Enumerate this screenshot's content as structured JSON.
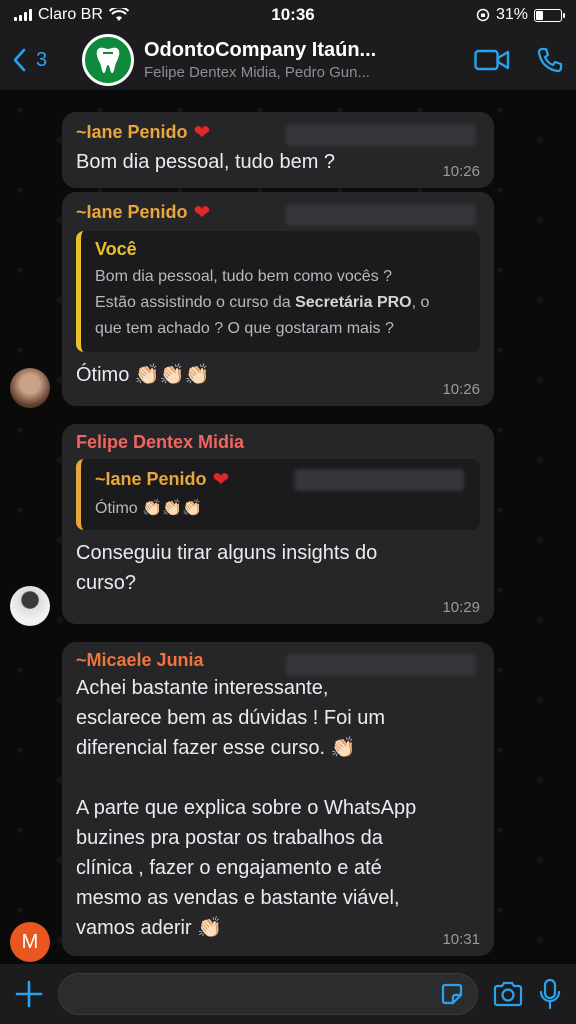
{
  "status": {
    "carrier": "Claro BR",
    "time": "10:36",
    "battery": "31%",
    "battery_level": 0.31
  },
  "header": {
    "back_count": "3",
    "title": "OdontoCompany Itaún...",
    "subtitle": "Felipe Dentex Midia, Pedro Gun..."
  },
  "messages": [
    {
      "sender": "~Iane Penido",
      "text": "Bom dia pessoal, tudo bem ?",
      "time": "10:26",
      "sender_color": "#e8a73a"
    },
    {
      "sender": "~Iane Penido",
      "quote_sender": "Você",
      "quote_line1": "Bom dia pessoal, tudo bem como vocês ?",
      "quote_line2_pre": "Estão assistindo o curso da ",
      "quote_line2_bold": "Secretária PRO",
      "quote_line2_post": ",  o",
      "quote_line3": "que tem achado ? O que gostaram mais ?",
      "text": "Ótimo 👏🏻👏🏻👏🏻",
      "time": "10:26"
    },
    {
      "sender": "Felipe Dentex Midia",
      "quote_sender": "~Iane Penido",
      "quote_text": "Ótimo 👏🏻👏🏻👏🏻",
      "text_line1": "Conseguiu tirar alguns insights do",
      "text_line2": "curso?",
      "time": "10:29",
      "sender_color": "#f0655f"
    },
    {
      "sender": "~Micaele Junia",
      "p1_line1": "Achei bastante interessante,",
      "p1_line2": "esclarece bem as dúvidas !  Foi um",
      "p1_line3": "diferencial fazer esse curso. 👏🏻",
      "p2_line1": "A parte que explica sobre o WhatsApp",
      "p2_line2": "buzines pra postar os trabalhos da",
      "p2_line3": "clínica , fazer o engajamento e até",
      "p2_line4": "mesmo as vendas e bastante viável,",
      "p2_line5": "vamos aderir 👏🏻",
      "time": "10:31",
      "sender_color": "#f0743d",
      "avatar_letter": "M"
    }
  ],
  "icons": {
    "back": "chevron-left-icon",
    "video": "video-camera-icon",
    "call": "phone-icon",
    "add": "plus-icon",
    "sticker": "sticker-icon",
    "camera": "camera-icon",
    "mic": "microphone-icon"
  },
  "colors": {
    "accent": "#2aa3ef",
    "bubble": "#262628",
    "quote_bar": "#e8c12b",
    "heart": "#e0272c"
  }
}
